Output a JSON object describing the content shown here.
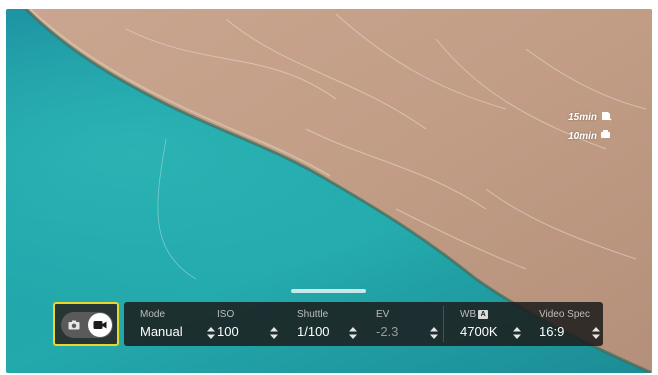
{
  "recording_estimates": [
    {
      "text": "15min",
      "icon": "card-storage-icon"
    },
    {
      "text": "10min",
      "icon": "drone-storage-icon"
    }
  ],
  "mode_switch": {
    "left_icon": "camera-icon",
    "active_icon": "video-camera-icon",
    "active": "video",
    "highlight_color": "#e9d62a"
  },
  "params": [
    {
      "id": "mode",
      "label": "Mode",
      "value": "Manual"
    },
    {
      "id": "iso",
      "label": "ISO",
      "value": "100"
    },
    {
      "id": "shuttle",
      "label": "Shuttle",
      "value": "1/100"
    },
    {
      "id": "ev",
      "label": "EV",
      "value": "-2.3",
      "disabled": true
    },
    {
      "id": "wb",
      "label": "WB",
      "badge": "A",
      "value": "4700K"
    },
    {
      "id": "video_spec",
      "label": "Video Spec",
      "value": "16:9"
    }
  ],
  "colors": {
    "panel": "#1c1c1c",
    "water": "#1fa5ab",
    "land": "#c8a58c"
  }
}
